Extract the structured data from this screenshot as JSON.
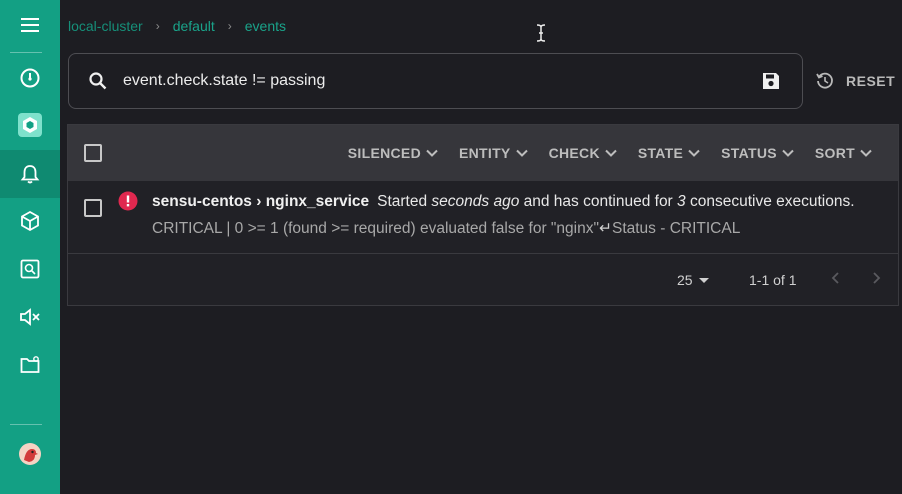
{
  "sidebar": {
    "items": [
      {
        "name": "menu",
        "icon": "hamburger-icon"
      },
      {
        "name": "dashboard",
        "icon": "gauge-icon"
      },
      {
        "name": "namespace",
        "icon": "namespace-badge-icon"
      },
      {
        "name": "events",
        "icon": "bell-icon",
        "active": true
      },
      {
        "name": "entities",
        "icon": "cube-icon"
      },
      {
        "name": "checks",
        "icon": "monitor-search-icon"
      },
      {
        "name": "silences",
        "icon": "speaker-mute-icon"
      },
      {
        "name": "configuration",
        "icon": "folder-gear-icon"
      },
      {
        "name": "profile",
        "icon": "avatar-icon"
      }
    ]
  },
  "breadcrumb": {
    "cluster": "local-cluster",
    "namespace": "default",
    "page": "events",
    "separator": "›"
  },
  "search": {
    "query": "event.check.state != passing"
  },
  "reset": {
    "label": "RESET"
  },
  "table": {
    "filters": [
      {
        "label": "SILENCED"
      },
      {
        "label": "ENTITY"
      },
      {
        "label": "CHECK"
      },
      {
        "label": "STATE"
      },
      {
        "label": "STATUS"
      },
      {
        "label": "SORT"
      }
    ],
    "rows": [
      {
        "status": "critical",
        "entity": "sensu-centos",
        "check": "nginx_service",
        "title_sep": "›",
        "summary_pre": "Started",
        "summary_time": "seconds ago",
        "summary_mid": "and has continued for",
        "summary_count": "3",
        "summary_post": "consecutive executions.",
        "output_a": "CRITICAL | 0 >= 1 (found >= required) evaluated false for \"nginx\"",
        "output_enter": "↵",
        "output_b": "Status - CRITICAL"
      }
    ]
  },
  "pagination": {
    "per_page": "25",
    "range": "1-1 of 1"
  },
  "colors": {
    "sidebar": "#13a084",
    "accent": "#1aa38a",
    "critical": "#e0284f",
    "background": "#1d1d22"
  }
}
